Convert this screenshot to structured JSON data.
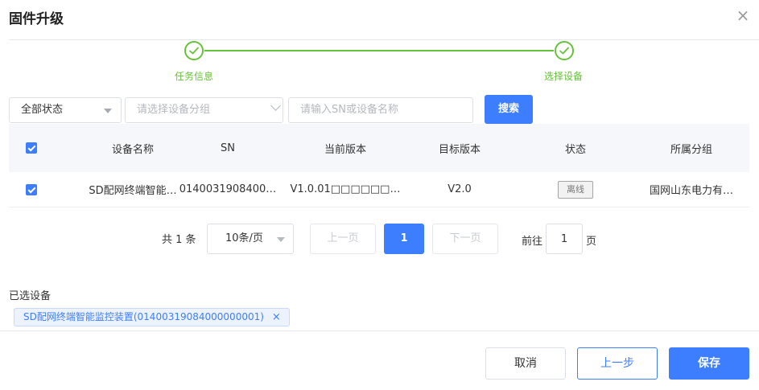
{
  "dialog": {
    "title": "固件升级",
    "close_icon": "close-icon"
  },
  "steps": [
    {
      "label": "任务信息",
      "status": "done"
    },
    {
      "label": "选择设备",
      "status": "done"
    }
  ],
  "filters": {
    "status_select": "全部状态",
    "group_placeholder": "请选择设备分组",
    "keyword_placeholder": "请输入SN或设备名称",
    "search_label": "搜索"
  },
  "table": {
    "columns": [
      "设备名称",
      "SN",
      "当前版本",
      "目标版本",
      "状态",
      "所属分组"
    ],
    "rows": [
      {
        "checked": true,
        "name": "SD配网终端智能…",
        "sn": "0140031908400…",
        "current_version": "V1.0.01□□□□□□…",
        "target_version": "V2.0",
        "status": "离线",
        "group": "国网山东电力有…"
      }
    ]
  },
  "pagination": {
    "total_text": "共 1 条",
    "page_size": "10条/页",
    "prev_label": "上一页",
    "current_page": "1",
    "next_label": "下一页",
    "goto_prefix": "前往",
    "goto_value": "1",
    "goto_suffix": "页"
  },
  "selected": {
    "title": "已选设备",
    "tags": [
      "SD配网终端智能监控装置(01400319084000000001)"
    ]
  },
  "footer": {
    "cancel_label": "取消",
    "prev_step_label": "上一步",
    "save_label": "保存"
  },
  "colors": {
    "primary": "#3d7eff",
    "success": "#67c23a"
  }
}
